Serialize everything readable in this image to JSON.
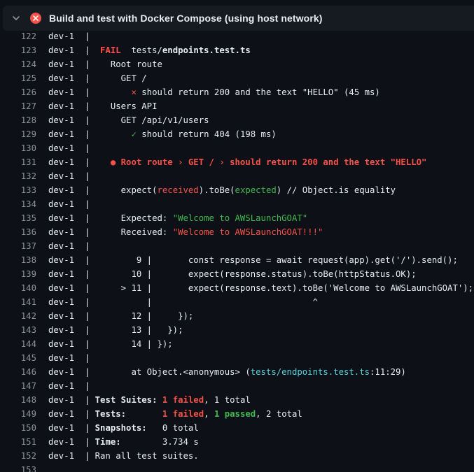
{
  "header": {
    "title": "Build and test with Docker Compose (using host network)"
  },
  "colors": {
    "fail": "#f85149",
    "pass": "#3fb950",
    "path": "#56d4dd",
    "text": "#e6edf3",
    "line_number": "#8b949e",
    "background": "#0d1117"
  },
  "icons": {
    "chevron": "chevron-down-icon",
    "status": "x-circle-fill-icon"
  },
  "log": [
    {
      "n": "122",
      "segs": [
        {
          "t": "dev-1  |"
        }
      ]
    },
    {
      "n": "123",
      "segs": [
        {
          "t": "dev-1  |  "
        },
        {
          "t": "FAIL",
          "c": "fail-badge"
        },
        {
          "t": "  tests/"
        },
        {
          "t": "endpoints.test.ts",
          "c": "b"
        }
      ]
    },
    {
      "n": "124",
      "segs": [
        {
          "t": "dev-1  |    Root route"
        }
      ]
    },
    {
      "n": "125",
      "segs": [
        {
          "t": "dev-1  |      GET /"
        }
      ]
    },
    {
      "n": "126",
      "segs": [
        {
          "t": "dev-1  |        "
        },
        {
          "t": "×",
          "c": "c-red"
        },
        {
          "t": " should return 200 and the text \"HELLO\" (45 ms)"
        }
      ]
    },
    {
      "n": "127",
      "segs": [
        {
          "t": "dev-1  |    Users API"
        }
      ]
    },
    {
      "n": "128",
      "segs": [
        {
          "t": "dev-1  |      GET /api/v1/users"
        }
      ]
    },
    {
      "n": "129",
      "segs": [
        {
          "t": "dev-1  |        "
        },
        {
          "t": "✓",
          "c": "c-green"
        },
        {
          "t": " should return 404 (198 ms)"
        }
      ]
    },
    {
      "n": "130",
      "segs": [
        {
          "t": "dev-1  |"
        }
      ]
    },
    {
      "n": "131",
      "segs": [
        {
          "t": "dev-1  |    "
        },
        {
          "t": "● Root route › GET / › should return 200 and the text \"HELLO\"",
          "c": "c-red b"
        }
      ]
    },
    {
      "n": "132",
      "segs": [
        {
          "t": "dev-1  |"
        }
      ]
    },
    {
      "n": "133",
      "segs": [
        {
          "t": "dev-1  |      expect("
        },
        {
          "t": "received",
          "c": "c-red"
        },
        {
          "t": ").toBe("
        },
        {
          "t": "expected",
          "c": "c-green"
        },
        {
          "t": ") // Object.is equality"
        }
      ]
    },
    {
      "n": "134",
      "segs": [
        {
          "t": "dev-1  |"
        }
      ]
    },
    {
      "n": "135",
      "segs": [
        {
          "t": "dev-1  |      Expected: "
        },
        {
          "t": "\"Welcome to AWSLaunchGOAT\"",
          "c": "c-green"
        }
      ]
    },
    {
      "n": "136",
      "segs": [
        {
          "t": "dev-1  |      Received: "
        },
        {
          "t": "\"Welcome to AWSLaunchGOAT!!!\"",
          "c": "c-red"
        }
      ]
    },
    {
      "n": "137",
      "segs": [
        {
          "t": "dev-1  |"
        }
      ]
    },
    {
      "n": "138",
      "segs": [
        {
          "t": "dev-1  |         9 |       const response = await request(app).get('/').send();"
        }
      ]
    },
    {
      "n": "139",
      "segs": [
        {
          "t": "dev-1  |        10 |       expect(response.status).toBe(httpStatus.OK);"
        }
      ]
    },
    {
      "n": "140",
      "segs": [
        {
          "t": "dev-1  |      > 11 |       expect(response.text).toBe('Welcome to AWSLaunchGOAT');"
        }
      ]
    },
    {
      "n": "141",
      "segs": [
        {
          "t": "dev-1  |           |                               ^"
        }
      ]
    },
    {
      "n": "142",
      "segs": [
        {
          "t": "dev-1  |        12 |     });"
        }
      ]
    },
    {
      "n": "143",
      "segs": [
        {
          "t": "dev-1  |        13 |   });"
        }
      ]
    },
    {
      "n": "144",
      "segs": [
        {
          "t": "dev-1  |        14 | });"
        }
      ]
    },
    {
      "n": "145",
      "segs": [
        {
          "t": "dev-1  |"
        }
      ]
    },
    {
      "n": "146",
      "segs": [
        {
          "t": "dev-1  |        at Object.<anonymous> ("
        },
        {
          "t": "tests/endpoints.test.ts",
          "c": "c-cyan"
        },
        {
          "t": ":11:29)"
        }
      ]
    },
    {
      "n": "147",
      "segs": [
        {
          "t": "dev-1  |"
        }
      ]
    },
    {
      "n": "148",
      "segs": [
        {
          "t": "dev-1  | "
        },
        {
          "t": "Test Suites:",
          "c": "b"
        },
        {
          "t": " "
        },
        {
          "t": "1 failed",
          "c": "c-red b"
        },
        {
          "t": ", 1 total"
        }
      ]
    },
    {
      "n": "149",
      "segs": [
        {
          "t": "dev-1  | "
        },
        {
          "t": "Tests:",
          "c": "b"
        },
        {
          "t": "       "
        },
        {
          "t": "1 failed",
          "c": "c-red b"
        },
        {
          "t": ", "
        },
        {
          "t": "1 passed",
          "c": "c-green b"
        },
        {
          "t": ", 2 total"
        }
      ]
    },
    {
      "n": "150",
      "segs": [
        {
          "t": "dev-1  | "
        },
        {
          "t": "Snapshots:",
          "c": "b"
        },
        {
          "t": "   0 total"
        }
      ]
    },
    {
      "n": "151",
      "segs": [
        {
          "t": "dev-1  | "
        },
        {
          "t": "Time:",
          "c": "b"
        },
        {
          "t": "        3.734 s"
        }
      ]
    },
    {
      "n": "152",
      "segs": [
        {
          "t": "dev-1  | Ran all test suites."
        }
      ]
    },
    {
      "n": "153",
      "segs": []
    }
  ]
}
